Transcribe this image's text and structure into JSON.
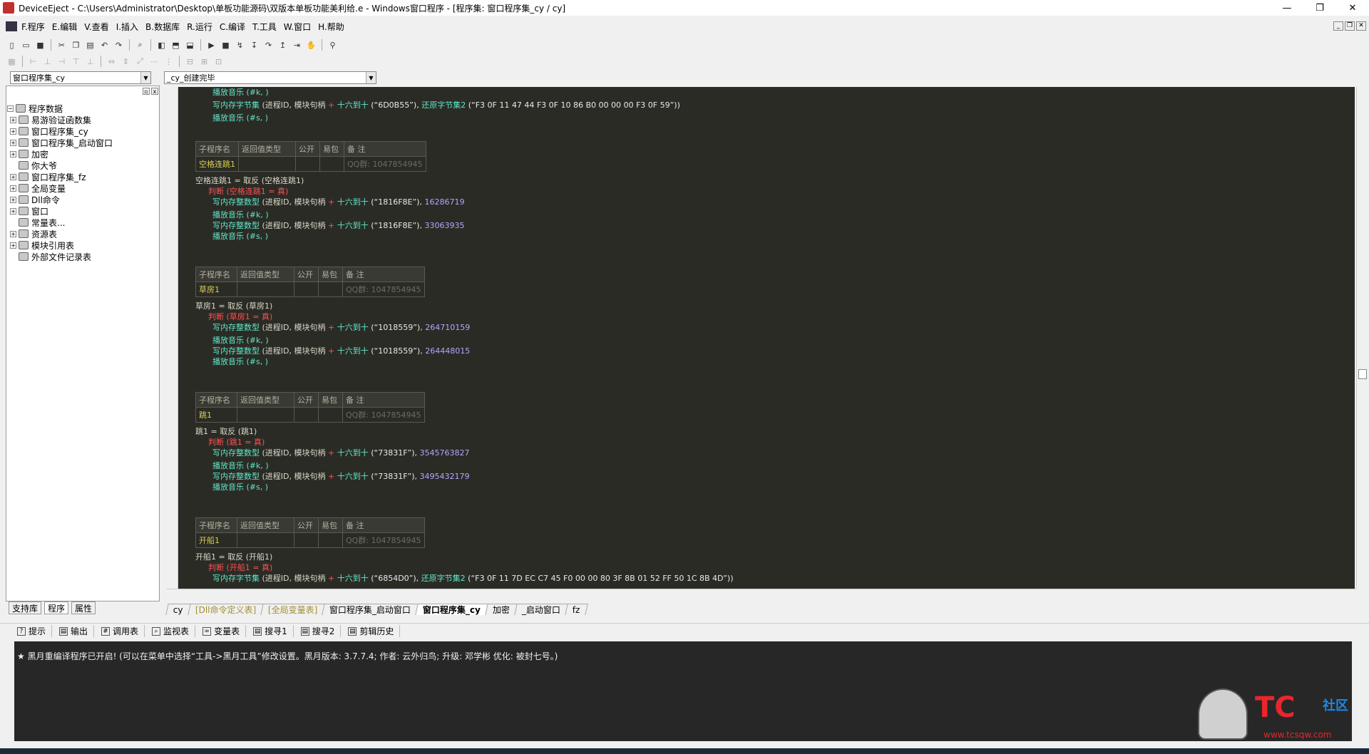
{
  "window": {
    "title": "DeviceEject - C:\\Users\\Administrator\\Desktop\\单板功能源码\\双版本单板功能美利给.e - Windows窗口程序 - [程序集: 窗口程序集_cy / cy]",
    "min_label": "—",
    "max_label": "❐",
    "close_label": "✕"
  },
  "menu": [
    "F.程序",
    "E.编辑",
    "V.查看",
    "I.插入",
    "B.数据库",
    "R.运行",
    "C.编译",
    "T.工具",
    "W.窗口",
    "H.帮助"
  ],
  "selectors": {
    "assembly": "窗口程序集_cy",
    "sub": "_cy_创建完毕"
  },
  "tree": [
    {
      "label": "程序数据",
      "pm": "−",
      "indent": 0
    },
    {
      "label": "易游验证函数集",
      "pm": "+",
      "indent": 1
    },
    {
      "label": "窗口程序集_cy",
      "pm": "+",
      "indent": 1
    },
    {
      "label": "窗口程序集_启动窗口",
      "pm": "+",
      "indent": 1
    },
    {
      "label": "加密",
      "pm": "+",
      "indent": 1
    },
    {
      "label": "你大爷",
      "pm": "",
      "indent": 1
    },
    {
      "label": "窗口程序集_fz",
      "pm": "+",
      "indent": 1
    },
    {
      "label": "全局变量",
      "pm": "+",
      "indent": 1
    },
    {
      "label": "Dll命令",
      "pm": "+",
      "indent": 1
    },
    {
      "label": "窗口",
      "pm": "+",
      "indent": 1
    },
    {
      "label": "常量表...",
      "pm": "",
      "indent": 1
    },
    {
      "label": "资源表",
      "pm": "+",
      "indent": 1
    },
    {
      "label": "模块引用表",
      "pm": "+",
      "indent": 1
    },
    {
      "label": "外部文件记录表",
      "pm": "",
      "indent": 1
    }
  ],
  "left_tabs": [
    "支持库",
    "程序",
    "属性"
  ],
  "sub_table": {
    "headers": [
      "子程序名",
      "返回值类型",
      "公开",
      "易包",
      "备 注"
    ],
    "qq": "QQ群: 1047854945"
  },
  "code": {
    "play_music_k": "播放音乐 (#k, )",
    "play_music_s": "播放音乐 (#s, )",
    "blocks": [
      {
        "pre": [
          {
            "kind": "play",
            "text": "播放音乐 (#k, )"
          },
          {
            "kind": "write2",
            "fn": "写内存字节集",
            "args": " (进程ID, 模块句柄 ",
            "plus": "+",
            "hex": " 十六到十 ",
            "str": "(“6D0B55”), ",
            "fn2": "还原字节集2",
            "str2": " (“F3 0F 11 47 44 F3 0F 10 86 B0 00 00 00 F3 0F 59”))"
          },
          {
            "kind": "play",
            "text": "播放音乐 (#s, )"
          }
        ]
      }
    ],
    "subs": [
      {
        "name": "空格连跳1",
        "assign": "空格连跳1 = 取反 (空格连跳1)",
        "judge": "判断 (空格连跳1 = 真)",
        "hex1": "(“1816F8E”)",
        "n1": "16286719",
        "hex2": "(“1816F8E”)",
        "n2": "33063935"
      },
      {
        "name": "草房1",
        "assign": "草房1 = 取反 (草房1)",
        "judge": "判断 (草房1 = 真)",
        "hex1": "(“1018559”)",
        "n1": "264710159",
        "hex2": "(“1018559”)",
        "n2": "264448015"
      },
      {
        "name": "跳1",
        "assign": "跳1 = 取反 (跳1)",
        "judge": "判断 (跳1 = 真)",
        "hex1": "(“73831F”)",
        "n1": "3545763827",
        "hex2": "(“73831F”)",
        "n2": "3495432179"
      },
      {
        "name": "开船1",
        "assign": "开船1 = 取反 (开船1)",
        "judge": "判断 (开船1 = 真)",
        "last_str": "(“6854D0”), ",
        "last_fn": "还原字节集2",
        "last_str2": " (“F3 0F 11 7D EC C7 45 F0 00 00 80 3F 8B 01 52 FF 50 1C 8B 4D”))"
      }
    ],
    "write_int": "写内存整数型",
    "write_bytes": "写内存字节集",
    "args": " (进程ID, 模块句柄 ",
    "plus": "+",
    "hex_fn": " 十六到十 "
  },
  "editor_tabs": [
    "cy",
    "[Dll命令定义表]",
    "[全局变量表]",
    "窗口程序集_启动窗口",
    "窗口程序集_cy",
    "加密",
    "_启动窗口",
    "fz"
  ],
  "bottom_tabs": [
    "提示",
    "输出",
    "调用表",
    "监视表",
    "变量表",
    "搜寻1",
    "搜寻2",
    "剪辑历史"
  ],
  "output_text": "★ 黑月重编译程序已开启!  (可以在菜单中选择“工具->黑月工具”修改设置。黑月版本: 3.7.7.4; 作者: 云外归鸟; 升级: 邓学彬 优化: 被封七号。)",
  "watermark": {
    "logo": "TC",
    "suffix": "社区",
    "url": "www.tcsqw.com"
  }
}
